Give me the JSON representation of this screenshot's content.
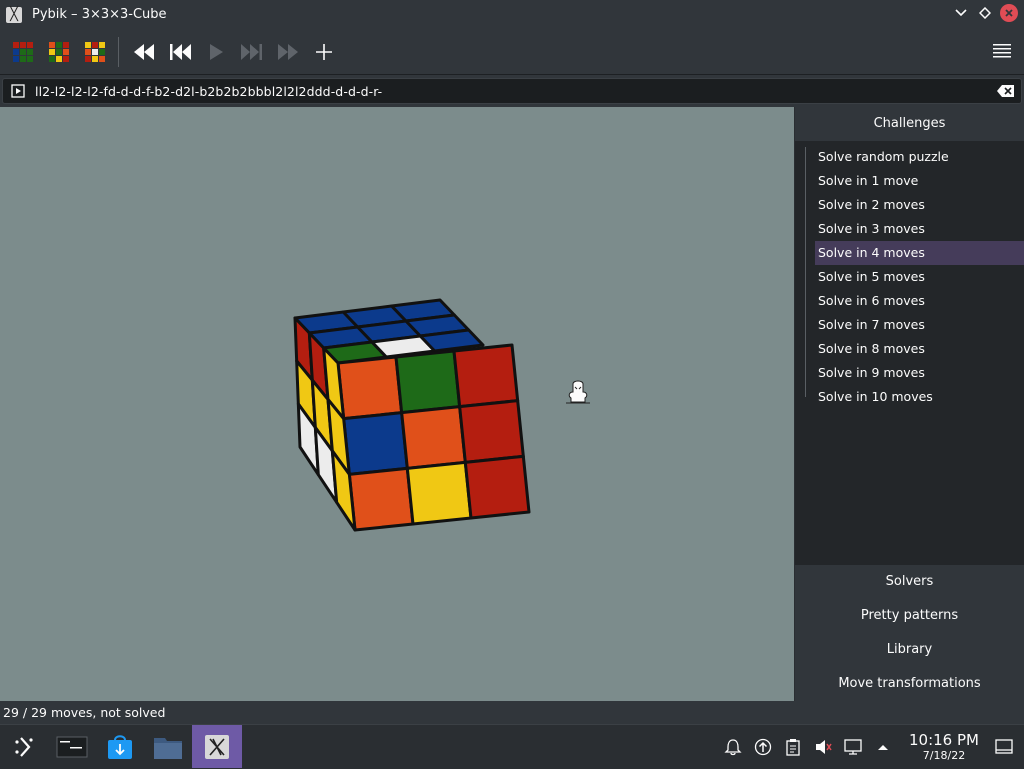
{
  "window": {
    "title": "Pybik – 3×3×3-Cube",
    "icon": "pybik-app-icon"
  },
  "toolbar": {
    "buttons": [
      {
        "name": "new-solved-puzzle-button",
        "icon": "cube-solved-icon"
      },
      {
        "name": "new-random-puzzle-button",
        "icon": "cube-random-icon"
      },
      {
        "name": "select-puzzle-button",
        "icon": "cube-select-icon"
      },
      {
        "name": "rewind-button",
        "icon": "rewind-icon"
      },
      {
        "name": "previous-button",
        "icon": "skip-back-icon"
      },
      {
        "name": "play-button",
        "icon": "play-icon"
      },
      {
        "name": "next-button",
        "icon": "skip-forward-icon"
      },
      {
        "name": "forward-button",
        "icon": "fast-forward-icon"
      },
      {
        "name": "add-mark-button",
        "icon": "plus-icon"
      }
    ],
    "menu_icon": "hamburger-menu-icon"
  },
  "moves_edit": {
    "value": "ll2-l2-l2-l2-fd-d-d-f-b2-d2l-b2b2b2bbbl2l2l2ddd-d-d-d-r-"
  },
  "sidebar": {
    "challenges_header": "Challenges",
    "challenges": [
      "Solve random puzzle",
      "Solve in 1 move",
      "Solve in 2 moves",
      "Solve in 3 moves",
      "Solve in 4 moves",
      "Solve in 5 moves",
      "Solve in 6 moves",
      "Solve in 7 moves",
      "Solve in 8 moves",
      "Solve in 9 moves",
      "Solve in 10 moves"
    ],
    "selected_index": 4,
    "sections": [
      "Solvers",
      "Pretty patterns",
      "Library",
      "Move transformations"
    ]
  },
  "status": {
    "text": "29 / 29 moves, not solved"
  },
  "taskbar": {
    "apps": [
      "app-launcher-icon",
      "pager-icon",
      "discover-store-icon",
      "file-manager-icon",
      "pybik-app-icon"
    ],
    "tray": [
      "notifications-icon",
      "updates-icon",
      "clipboard-icon",
      "volume-muted-icon",
      "network-icon",
      "expand-tray-icon"
    ],
    "clock": {
      "time": "10:16 PM",
      "date": "7/18/22"
    }
  },
  "colors": {
    "accent": "#6e5aa6",
    "selection": "#453c5a",
    "close": "#e04c55",
    "viewport_bg": "#7c8c8c",
    "cube": {
      "red": "#b41e10",
      "blue": "#0c3a8c",
      "white": "#ececec",
      "green": "#1e6a18",
      "yellow": "#f0c814",
      "orange": "#e0501a"
    }
  }
}
